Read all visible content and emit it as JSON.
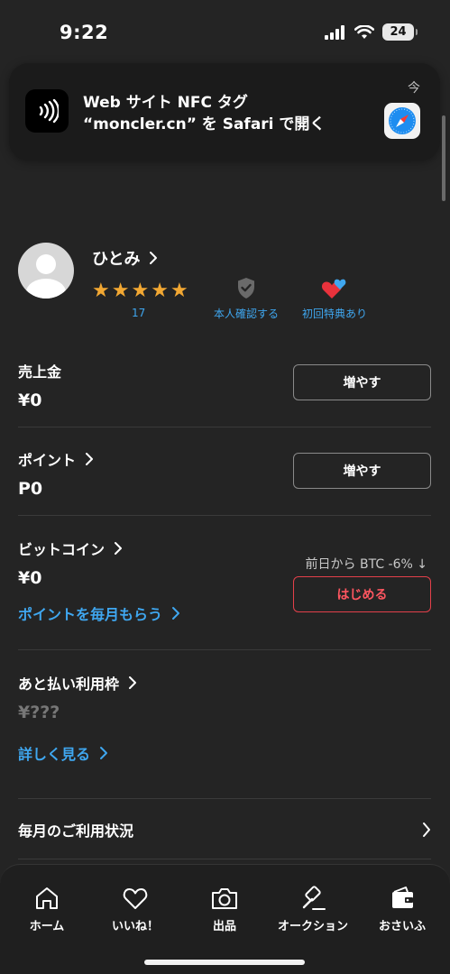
{
  "status_bar": {
    "time": "9:22",
    "battery": "24"
  },
  "notification": {
    "title": "Web サイト NFC タグ",
    "subtitle": "“moncler.cn” を Safari で開く",
    "time": "今",
    "app_icon": "nfc-icon",
    "action_icon": "safari-icon"
  },
  "profile": {
    "name": "ひとみ",
    "rating_stars": 5,
    "rating_count": "17",
    "verify_label": "本人確認する",
    "first_benefit_label": "初回特典あり"
  },
  "sales": {
    "title": "売上金",
    "value": "¥0",
    "button": "増やす"
  },
  "points": {
    "title": "ポイント",
    "value": "P0",
    "button": "増やす"
  },
  "bitcoin": {
    "title": "ビットコイン",
    "value": "¥0",
    "rate": "前日から BTC -6%",
    "rate_direction": "down",
    "button": "はじめる",
    "link": "ポイントを毎月もらう"
  },
  "deferred": {
    "title": "あと払い利用枠",
    "value": "¥???",
    "link": "詳しく見る"
  },
  "usage": {
    "label": "毎月のご利用状況"
  },
  "tabs": [
    {
      "label": "ホーム",
      "icon": "home-icon"
    },
    {
      "label": "いいね！",
      "icon": "heart-icon"
    },
    {
      "label": "出品",
      "icon": "camera-icon"
    },
    {
      "label": "オークション",
      "icon": "gavel-icon"
    },
    {
      "label": "おさいふ",
      "icon": "wallet-icon"
    }
  ],
  "colors": {
    "background": "#242424",
    "link_blue": "#3fa7f0",
    "star": "#f2a833",
    "danger": "#e3404a"
  }
}
